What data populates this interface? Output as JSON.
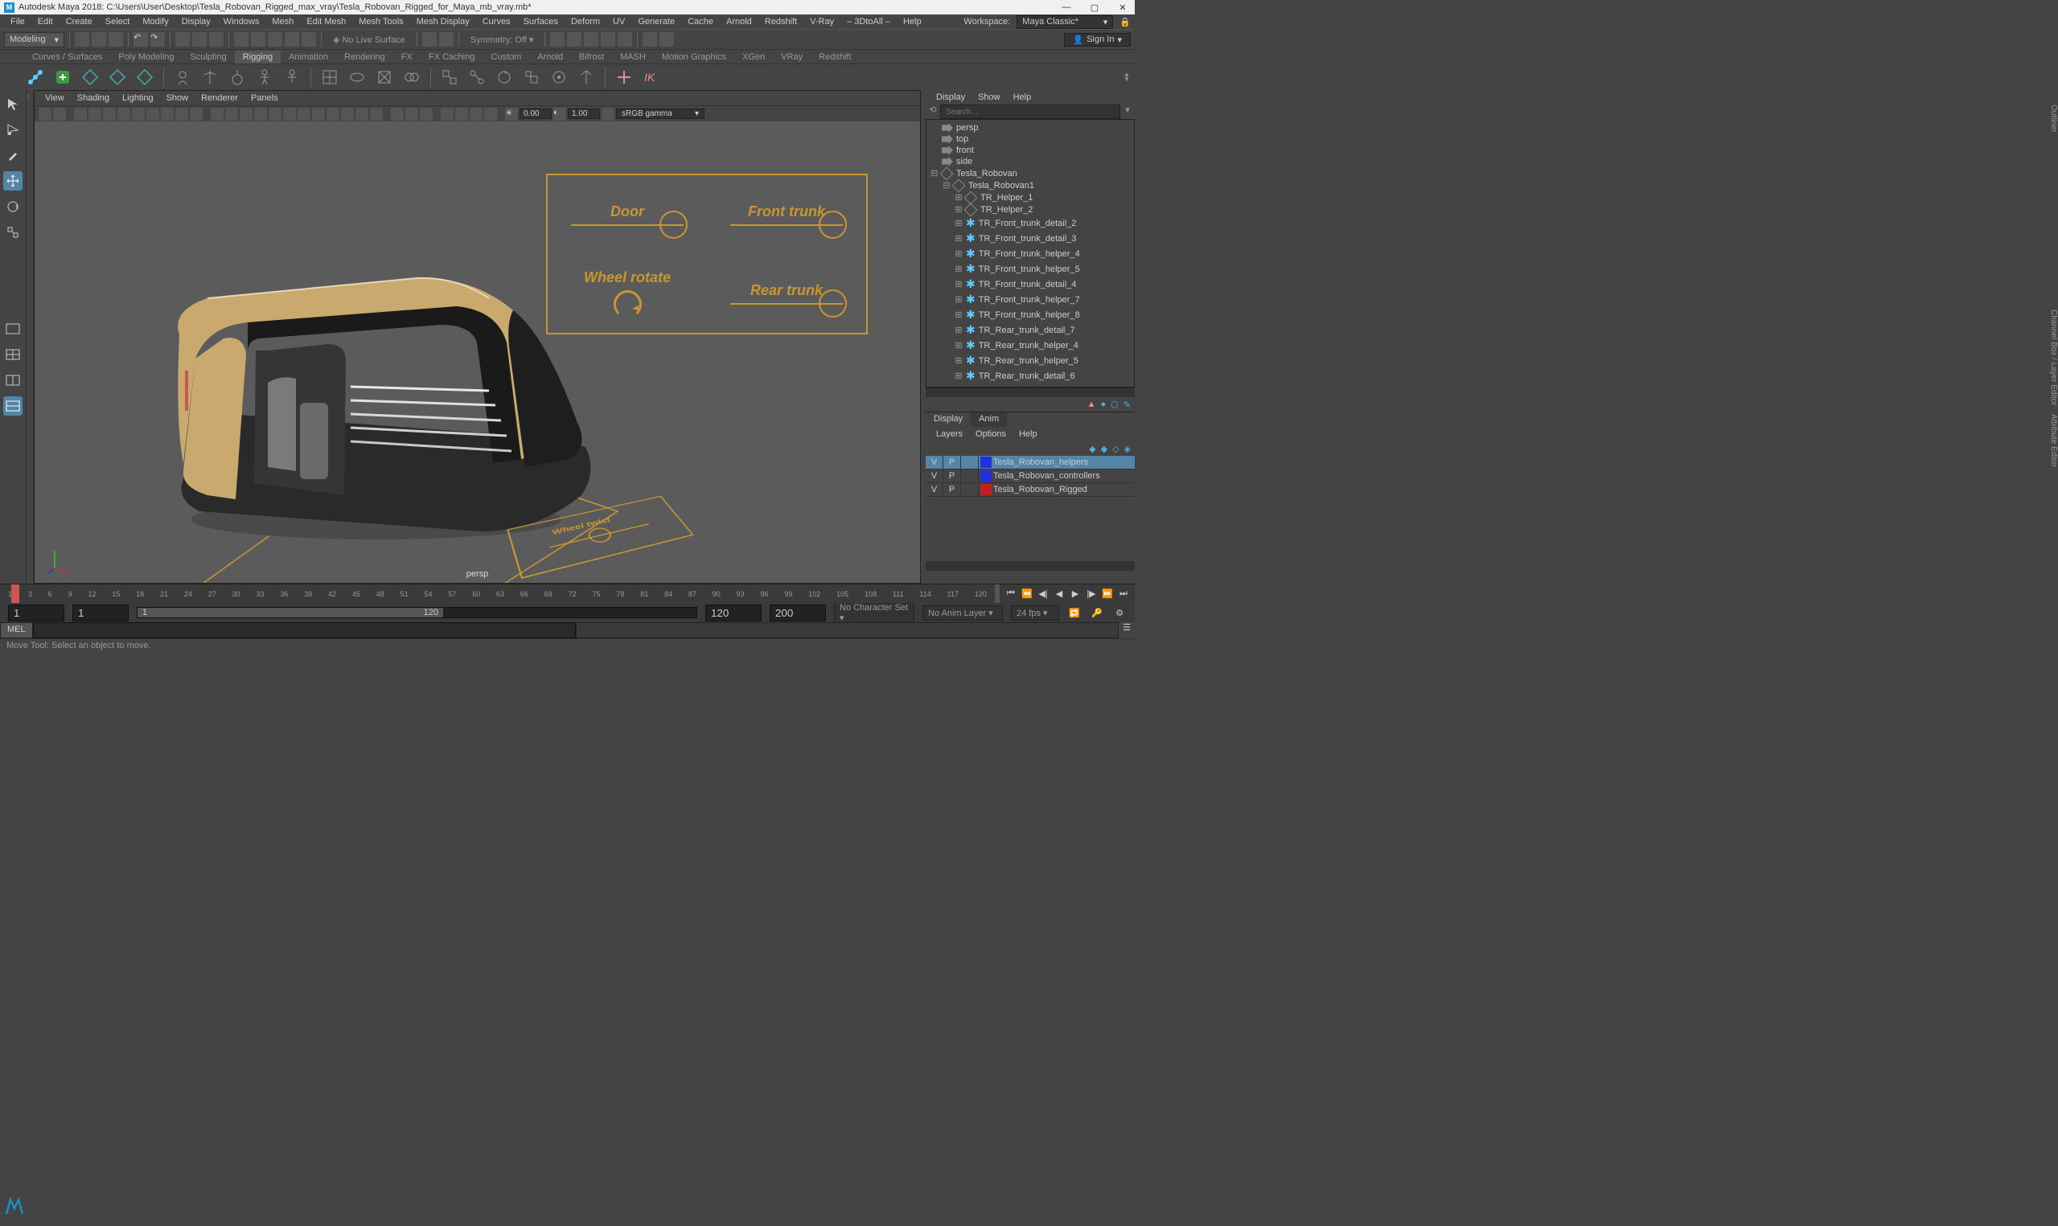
{
  "title": "Autodesk Maya 2018: C:\\Users\\User\\Desktop\\Tesla_Robovan_Rigged_max_vray\\Tesla_Robovan_Rigged_for_Maya_mb_vray.mb*",
  "menubar": [
    "File",
    "Edit",
    "Create",
    "Select",
    "Modify",
    "Display",
    "Windows",
    "Mesh",
    "Edit Mesh",
    "Mesh Tools",
    "Mesh Display",
    "Curves",
    "Surfaces",
    "Deform",
    "UV",
    "Generate",
    "Cache",
    "Arnold",
    "Redshift",
    "V-Ray",
    "– 3DtoAll –",
    "Help"
  ],
  "workspace_label": "Workspace:",
  "workspace_value": "Maya Classic*",
  "module": "Modeling",
  "no_live": "No Live Surface",
  "symmetry": "Symmetry: Off",
  "signin": "Sign In",
  "shelves": [
    "Curves / Surfaces",
    "Poly Modeling",
    "Sculpting",
    "Rigging",
    "Animation",
    "Rendering",
    "FX",
    "FX Caching",
    "Custom",
    "Arnold",
    "Bifrost",
    "MASH",
    "Motion Graphics",
    "XGen",
    "VRay",
    "Redshift"
  ],
  "active_shelf": "Rigging",
  "viewport_menus": [
    "View",
    "Shading",
    "Lighting",
    "Show",
    "Renderer",
    "Panels"
  ],
  "view_num1": "0.00",
  "view_num2": "1.00",
  "gamma": "sRGB gamma",
  "persp": "persp",
  "rig": {
    "door": "Door",
    "front_trunk": "Front trunk",
    "wheel_rotate": "Wheel rotate",
    "rear_trunk": "Rear trunk",
    "wheel_twist": "Wheel twist"
  },
  "rightpanel_menus": [
    "Display",
    "Show",
    "Help"
  ],
  "search_ph": "Search...",
  "outliner": [
    {
      "label": "persp",
      "type": "cam",
      "indent": 0
    },
    {
      "label": "top",
      "type": "cam",
      "indent": 0
    },
    {
      "label": "front",
      "type": "cam",
      "indent": 0
    },
    {
      "label": "side",
      "type": "cam",
      "indent": 0
    },
    {
      "label": "Tesla_Robovan",
      "type": "group",
      "indent": 0,
      "exp": "−"
    },
    {
      "label": "Tesla_Robovan1",
      "type": "transform",
      "indent": 1,
      "exp": "−"
    },
    {
      "label": "TR_Helper_1",
      "type": "transform",
      "indent": 2,
      "exp": "+"
    },
    {
      "label": "TR_Helper_2",
      "type": "transform",
      "indent": 2,
      "exp": "+"
    },
    {
      "label": "TR_Front_trunk_detail_2",
      "type": "helper",
      "indent": 2,
      "exp": "+"
    },
    {
      "label": "TR_Front_trunk_detail_3",
      "type": "helper",
      "indent": 2,
      "exp": "+"
    },
    {
      "label": "TR_Front_trunk_helper_4",
      "type": "helper",
      "indent": 2,
      "exp": "+"
    },
    {
      "label": "TR_Front_trunk_helper_5",
      "type": "helper",
      "indent": 2,
      "exp": "+"
    },
    {
      "label": "TR_Front_trunk_detail_4",
      "type": "helper",
      "indent": 2,
      "exp": "+"
    },
    {
      "label": "TR_Front_trunk_helper_7",
      "type": "helper",
      "indent": 2,
      "exp": "+"
    },
    {
      "label": "TR_Front_trunk_helper_8",
      "type": "helper",
      "indent": 2,
      "exp": "+"
    },
    {
      "label": "TR_Rear_trunk_detail_7",
      "type": "helper",
      "indent": 2,
      "exp": "+"
    },
    {
      "label": "TR_Rear_trunk_helper_4",
      "type": "helper",
      "indent": 2,
      "exp": "+"
    },
    {
      "label": "TR_Rear_trunk_helper_5",
      "type": "helper",
      "indent": 2,
      "exp": "+"
    },
    {
      "label": "TR_Rear_trunk_detail_6",
      "type": "helper",
      "indent": 2,
      "exp": "+"
    }
  ],
  "channel_tabs": {
    "display": "Display",
    "anim": "Anim"
  },
  "layer_menus": [
    "Layers",
    "Options",
    "Help"
  ],
  "layers": [
    {
      "v": "V",
      "p": "P",
      "color": "#2030e0",
      "name": "Tesla_Robovan_helpers",
      "selected": true
    },
    {
      "v": "V",
      "p": "P",
      "color": "#2030e0",
      "name": "Tesla_Robovan_controllers",
      "selected": false
    },
    {
      "v": "V",
      "p": "P",
      "color": "#c02020",
      "name": "Tesla_Robovan_Rigged",
      "selected": false
    }
  ],
  "side_tabs": [
    "Outliner",
    "Channel Box / Layer Editor",
    "Attribute Editor"
  ],
  "timeline_ticks": [
    "1",
    "3",
    "6",
    "9",
    "12",
    "15",
    "18",
    "21",
    "24",
    "27",
    "30",
    "33",
    "36",
    "39",
    "42",
    "45",
    "48",
    "51",
    "54",
    "57",
    "60",
    "63",
    "66",
    "69",
    "72",
    "75",
    "78",
    "81",
    "84",
    "87",
    "90",
    "93",
    "96",
    "99",
    "102",
    "105",
    "108",
    "111",
    "114",
    "117",
    "120"
  ],
  "range": {
    "start_out": "1",
    "start_in": "1",
    "end_in": "120",
    "end_out": "120",
    "end_range": "200"
  },
  "char_set": "No Character Set",
  "anim_layer": "No Anim Layer",
  "fps": "24 fps",
  "cmd_label": "MEL",
  "helpline": "Move Tool: Select an object to move."
}
